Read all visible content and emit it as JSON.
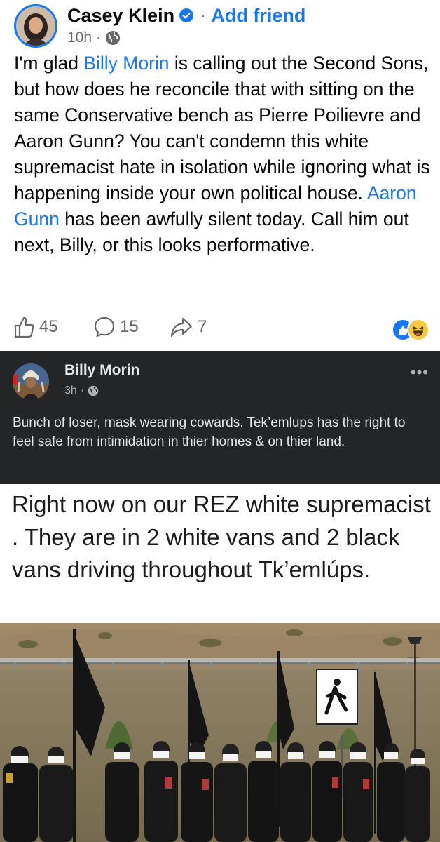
{
  "comment": {
    "author": "Casey Klein",
    "add_friend": "Add friend",
    "dot": "·",
    "time": "10h",
    "time_sep": "·",
    "text_parts": [
      "I'm glad ",
      "Billy Morin",
      " is calling out the Second Sons, but how does he reconcile that with sitting on the same Conservative bench as Pierre Poilievre and Aaron Gunn? You can't condemn this white supremacist hate in isolation while ignoring what is happening inside your own political house. ",
      "Aaron Gunn",
      " has been awfully silent today. Call him out next, Billy, or this looks performative."
    ],
    "likes": "45",
    "comments": "15",
    "shares": "7",
    "icons": {
      "verified": "verified-badge-icon",
      "audience": "globe-icon",
      "like": "thumbs-up-icon",
      "comment": "comment-bubble-icon",
      "share": "share-arrow-icon",
      "reactions": [
        "like-reaction-icon",
        "haha-reaction-icon"
      ]
    },
    "colors": {
      "link": "#1877f2",
      "text": "#050505",
      "muted": "#65676b"
    }
  },
  "shared_post": {
    "author": "Billy Morin",
    "time": "3h",
    "time_sep": "·",
    "more": "•••",
    "text": "Bunch of loser, mask wearing cowards. Tek’emlups has the right to feel safe from intimidation in thier homes & on thier land.",
    "colors": {
      "background": "#242526",
      "text": "#e4e6eb",
      "muted": "#b0b3b8"
    }
  },
  "image_caption": {
    "text": "Right now on our REZ white supremacist . They are in 2 white vans and 2 black vans driving throughout Tk’emlúps."
  }
}
